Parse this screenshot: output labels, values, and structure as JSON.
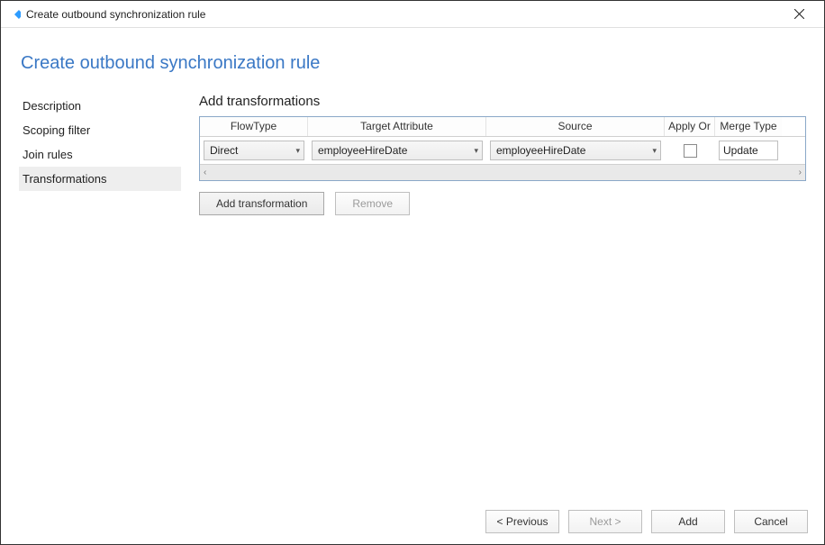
{
  "window": {
    "title": "Create outbound synchronization rule"
  },
  "page": {
    "heading": "Create outbound synchronization rule"
  },
  "sidebar": {
    "items": [
      {
        "label": "Description",
        "active": false
      },
      {
        "label": "Scoping filter",
        "active": false
      },
      {
        "label": "Join rules",
        "active": false
      },
      {
        "label": "Transformations",
        "active": true
      }
    ]
  },
  "main": {
    "section_title": "Add transformations",
    "columns": {
      "flowtype": "FlowType",
      "target": "Target Attribute",
      "source": "Source",
      "apply": "Apply Or",
      "merge": "Merge Type"
    },
    "rows": [
      {
        "flowtype": "Direct",
        "target": "employeeHireDate",
        "source": "employeeHireDate",
        "apply_once": false,
        "merge": "Update"
      }
    ],
    "buttons": {
      "add_transformation": "Add transformation",
      "remove": "Remove"
    }
  },
  "footer": {
    "previous": "< Previous",
    "next": "Next >",
    "add": "Add",
    "cancel": "Cancel"
  }
}
